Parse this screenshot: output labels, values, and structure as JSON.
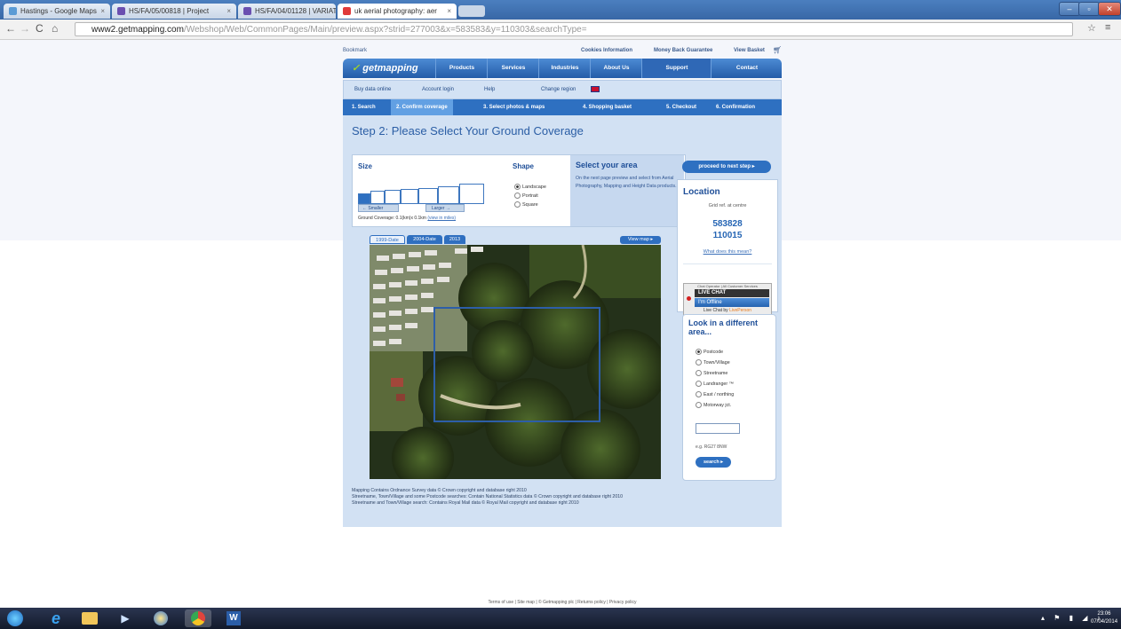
{
  "browser": {
    "tabs": [
      {
        "title": "Hastings - Google Maps",
        "favicon_color": "#5b9bd5"
      },
      {
        "title": "HS/FA/05/00818 | Project",
        "favicon_color": "#6a4fb0"
      },
      {
        "title": "HS/FA/04/01128 | VARIAT",
        "favicon_color": "#6a4fb0"
      },
      {
        "title": "uk aerial photography: aer",
        "favicon_color": "#e03a3a"
      }
    ],
    "url_domain": "www2.getmapping.com",
    "url_path": "/Webshop/Web/CommonPages/Main/preview.aspx?strid=277003&x=583583&y=110303&searchType="
  },
  "site": {
    "toplinks": {
      "bookmark": "Bookmark",
      "cookies": "Cookies Information",
      "money_back": "Money Back Guarantee",
      "basket": "View Basket"
    },
    "logo": "getmapping",
    "main_nav": [
      "Products",
      "Services",
      "Industries",
      "About Us",
      "Support",
      "Contact"
    ],
    "sub_nav": [
      "Buy data online",
      "Account login",
      "Help",
      "Change region"
    ],
    "steps": [
      "1. Search",
      "2. Confirm coverage",
      "3. Select photos & maps",
      "4. Shopping basket",
      "5. Checkout",
      "6. Confirmation"
    ],
    "step_title": "Step 2: Please Select Your Ground Coverage",
    "size": {
      "heading": "Size",
      "smaller": "← Smaller",
      "larger": "Larger →",
      "coverage": "Ground Coverage: 0.1(km)x 0.1km",
      "coverage_link": "(view in miles)"
    },
    "shape": {
      "heading": "Shape",
      "options": [
        {
          "label": "Landscape",
          "selected": true
        },
        {
          "label": "Portrait",
          "selected": false
        },
        {
          "label": "Square",
          "selected": false
        }
      ]
    },
    "select_area": {
      "heading": "Select your area",
      "text": "On the next page preview and select from Aerial Photography, Mapping and Height Data products."
    },
    "map": {
      "tabs": [
        "1999-Date",
        "2004-Date",
        "2013"
      ],
      "view_map": "View map ▸"
    },
    "proceed": "proceed to next step ▸",
    "location": {
      "heading": "Location",
      "grid_label": "Grid ref. at centre",
      "easting": "583828",
      "northing": "110015",
      "what_link": "What does this mean?"
    },
    "chat": {
      "label": "Chat Operator | All Customer Services",
      "live": "LIVE CHAT",
      "status": "I'm Offline",
      "provider": "Live Chat by",
      "provider_brand": "LivePerson"
    },
    "look": {
      "heading": "Look in a different area...",
      "options": [
        {
          "label": "Postcode",
          "selected": true
        },
        {
          "label": "Town/Village",
          "selected": false
        },
        {
          "label": "Streetname",
          "selected": false
        },
        {
          "label": "Landranger ™",
          "selected": false
        },
        {
          "label": "East / northing",
          "selected": false
        },
        {
          "label": "Motorway jct.",
          "selected": false
        }
      ],
      "input_value": "",
      "example": "e.g. RG27 8NW",
      "search": "search ▸"
    },
    "copyright": [
      "Mapping Contains Ordnance Survey data © Crown copyright and database right 2010",
      "Streetname, Town/Village and some Postcode searches: Contain National Statistics data © Crown copyright and database right 2010",
      "Streetname and Town/Village search: Contains Royal Mail data © Royal Mail copyright and database right 2010"
    ],
    "footer": "Terms of use | Site map | © Getmapping plc | Returns policy | Privacy policy"
  },
  "taskbar": {
    "time": "23:06",
    "date": "07/04/2014"
  },
  "colors": {
    "brand_blue": "#2e70c1",
    "accent_green": "#9ed22e",
    "page_panel": "#d2e1f3"
  }
}
